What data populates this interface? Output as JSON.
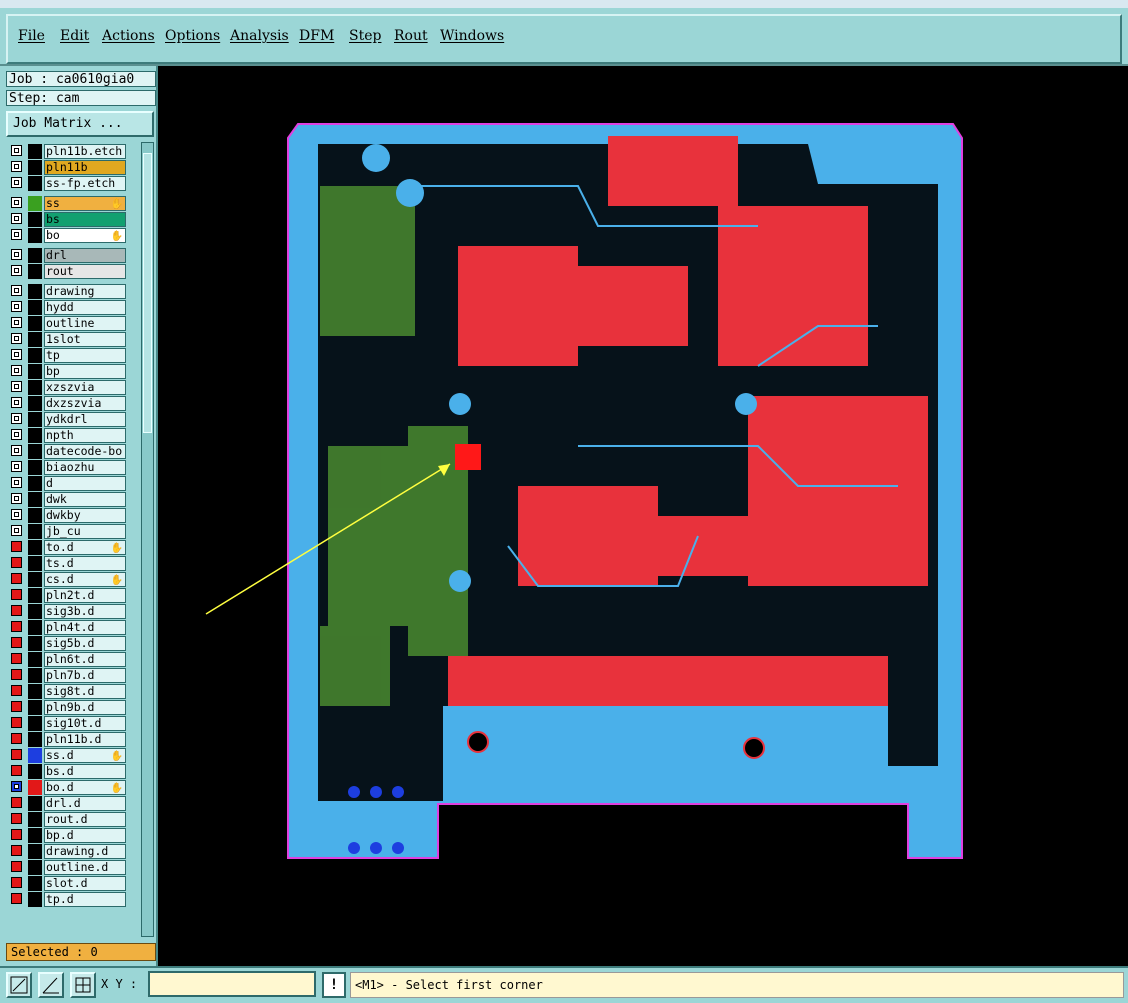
{
  "menu": [
    "File",
    "Edit",
    "Actions",
    "Options",
    "Analysis",
    "DFM",
    "Step",
    "Rout",
    "Windows"
  ],
  "job": {
    "label": "Job : ca0610gia0",
    "step": "Step: cam",
    "matrix_button": "Job Matrix ..."
  },
  "layers": [
    {
      "name": "pln11b.etch",
      "cb": "white",
      "color": "#000000",
      "bg": "#dff4f4"
    },
    {
      "name": "pln11b",
      "cb": "white",
      "color": "#000000",
      "bg": "#e0a820"
    },
    {
      "name": "ss-fp.etch",
      "cb": "white",
      "color": "#000000",
      "bg": "#dff4f4"
    },
    {
      "name": "ss",
      "cb": "white",
      "color": "#3aa020",
      "bg": "#f0b040",
      "hand": true
    },
    {
      "name": "bs",
      "cb": "white",
      "color": "#000000",
      "bg": "#12a070"
    },
    {
      "name": "bo",
      "cb": "white",
      "color": "#000000",
      "bg": "#ffffff",
      "hand": true
    },
    {
      "name": "drl",
      "cb": "white",
      "color": "#000000",
      "bg": "#a8b8b8"
    },
    {
      "name": "rout",
      "cb": "white",
      "color": "#000000",
      "bg": "#e6e6e6"
    },
    {
      "name": "drawing",
      "cb": "white",
      "color": "#000000",
      "bg": "#dff4f4"
    },
    {
      "name": "hydd",
      "cb": "white",
      "color": "#000000",
      "bg": "#dff4f4"
    },
    {
      "name": "outline",
      "cb": "white",
      "color": "#000000",
      "bg": "#dff4f4"
    },
    {
      "name": "1slot",
      "cb": "white",
      "color": "#000000",
      "bg": "#dff4f4"
    },
    {
      "name": "tp",
      "cb": "white",
      "color": "#000000",
      "bg": "#dff4f4"
    },
    {
      "name": "bp",
      "cb": "white",
      "color": "#000000",
      "bg": "#dff4f4"
    },
    {
      "name": "xzszvia",
      "cb": "white",
      "color": "#000000",
      "bg": "#dff4f4"
    },
    {
      "name": "dxzszvia",
      "cb": "white",
      "color": "#000000",
      "bg": "#dff4f4"
    },
    {
      "name": "ydkdrl",
      "cb": "white",
      "color": "#000000",
      "bg": "#dff4f4"
    },
    {
      "name": "npth",
      "cb": "white",
      "color": "#000000",
      "bg": "#dff4f4"
    },
    {
      "name": "datecode-bo",
      "cb": "white",
      "color": "#000000",
      "bg": "#dff4f4"
    },
    {
      "name": "biaozhu",
      "cb": "white",
      "color": "#000000",
      "bg": "#dff4f4"
    },
    {
      "name": "d",
      "cb": "white",
      "color": "#000000",
      "bg": "#dff4f4"
    },
    {
      "name": "dwk",
      "cb": "white",
      "color": "#000000",
      "bg": "#dff4f4"
    },
    {
      "name": "dwkby",
      "cb": "white",
      "color": "#000000",
      "bg": "#dff4f4"
    },
    {
      "name": "jb_cu",
      "cb": "white",
      "color": "#000000",
      "bg": "#dff4f4"
    },
    {
      "name": "to.d",
      "cb": "red",
      "color": "#000000",
      "bg": "#dff4f4",
      "hand": true
    },
    {
      "name": "ts.d",
      "cb": "red",
      "color": "#000000",
      "bg": "#dff4f4"
    },
    {
      "name": "cs.d",
      "cb": "red",
      "color": "#000000",
      "bg": "#dff4f4",
      "hand": true
    },
    {
      "name": "pln2t.d",
      "cb": "red",
      "color": "#000000",
      "bg": "#dff4f4"
    },
    {
      "name": "sig3b.d",
      "cb": "red",
      "color": "#000000",
      "bg": "#dff4f4"
    },
    {
      "name": "pln4t.d",
      "cb": "red",
      "color": "#000000",
      "bg": "#dff4f4"
    },
    {
      "name": "sig5b.d",
      "cb": "red",
      "color": "#000000",
      "bg": "#dff4f4"
    },
    {
      "name": "pln6t.d",
      "cb": "red",
      "color": "#000000",
      "bg": "#dff4f4"
    },
    {
      "name": "pln7b.d",
      "cb": "red",
      "color": "#000000",
      "bg": "#dff4f4"
    },
    {
      "name": "sig8t.d",
      "cb": "red",
      "color": "#000000",
      "bg": "#dff4f4"
    },
    {
      "name": "pln9b.d",
      "cb": "red",
      "color": "#000000",
      "bg": "#dff4f4"
    },
    {
      "name": "sig10t.d",
      "cb": "red",
      "color": "#000000",
      "bg": "#dff4f4"
    },
    {
      "name": "pln11b.d",
      "cb": "red",
      "color": "#000000",
      "bg": "#dff4f4"
    },
    {
      "name": "ss.d",
      "cb": "red",
      "color": "#1d3ee0",
      "bg": "#dff4f4",
      "hand": true
    },
    {
      "name": "bs.d",
      "cb": "red",
      "color": "#000000",
      "bg": "#dff4f4"
    },
    {
      "name": "bo.d",
      "cb": "blue",
      "color": "#e21818",
      "bg": "#dff4f4",
      "hand": true
    },
    {
      "name": "drl.d",
      "cb": "red",
      "color": "#000000",
      "bg": "#dff4f4"
    },
    {
      "name": "rout.d",
      "cb": "red",
      "color": "#000000",
      "bg": "#dff4f4"
    },
    {
      "name": "bp.d",
      "cb": "red",
      "color": "#000000",
      "bg": "#dff4f4"
    },
    {
      "name": "drawing.d",
      "cb": "red",
      "color": "#000000",
      "bg": "#dff4f4"
    },
    {
      "name": "outline.d",
      "cb": "red",
      "color": "#000000",
      "bg": "#dff4f4"
    },
    {
      "name": "slot.d",
      "cb": "red",
      "color": "#000000",
      "bg": "#dff4f4"
    },
    {
      "name": "tp.d",
      "cb": "red",
      "color": "#000000",
      "bg": "#dff4f4"
    }
  ],
  "selected": "Selected : 0",
  "bottom": {
    "xy_label": "X Y :",
    "xy_value": "",
    "excl": "!",
    "status": "<M1> - Select first corner"
  },
  "colors": {
    "board": "#4ab0ea",
    "pads": "#e8323c",
    "silk": "#4a8a30",
    "outline": "#e040e0",
    "arrow": "#ffff40",
    "highlight": "#ff1818"
  }
}
